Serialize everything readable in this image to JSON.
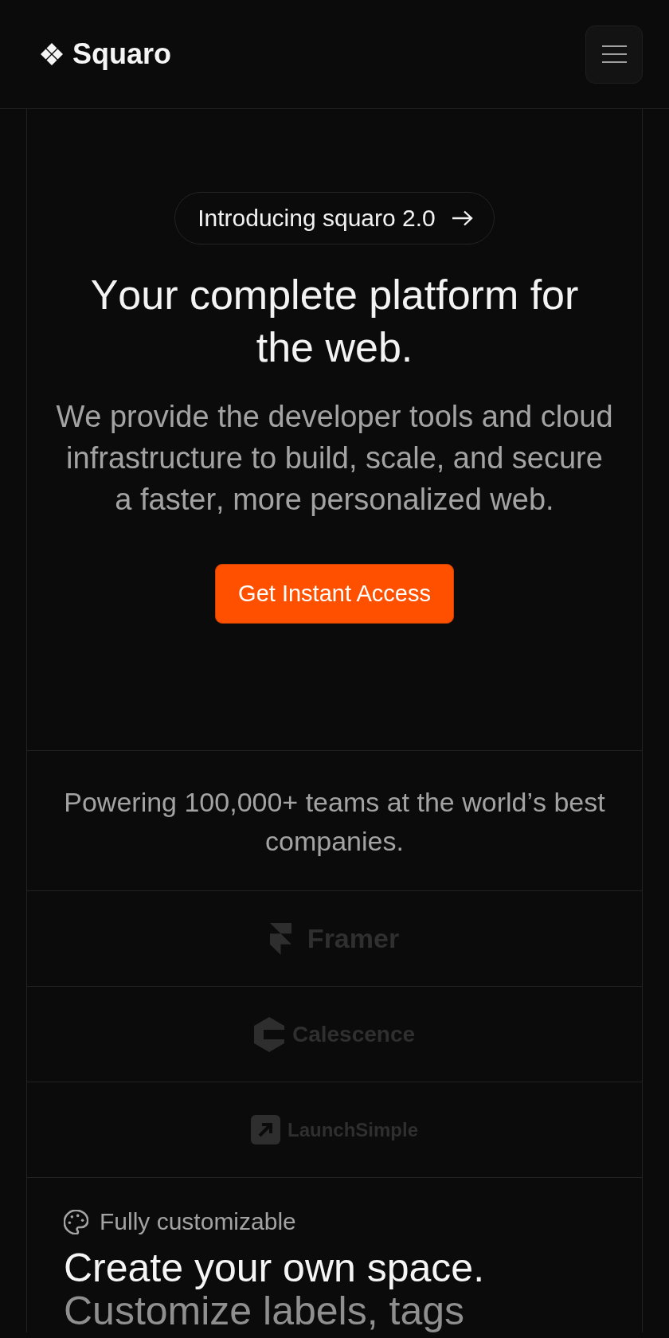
{
  "header": {
    "brand": "Squaro"
  },
  "hero": {
    "badge": "Introducing squaro 2.0",
    "title": "Your complete platform for the web.",
    "description": "We provide the developer tools and cloud infrastructure to build, scale, and secure a faster, more personalized web.",
    "cta": "Get Instant Access"
  },
  "social_proof": {
    "text": "Powering 100,000+ teams at the world’s best companies.",
    "logos": [
      {
        "name": "Framer",
        "kind": "folded"
      },
      {
        "name": "Calescence",
        "kind": "hexagon"
      },
      {
        "name": "LaunchSimple",
        "kind": "arrow"
      }
    ]
  },
  "feature": {
    "label": "Fully customizable",
    "title": "Create your own space.",
    "subtitle": "Customize labels, tags"
  }
}
